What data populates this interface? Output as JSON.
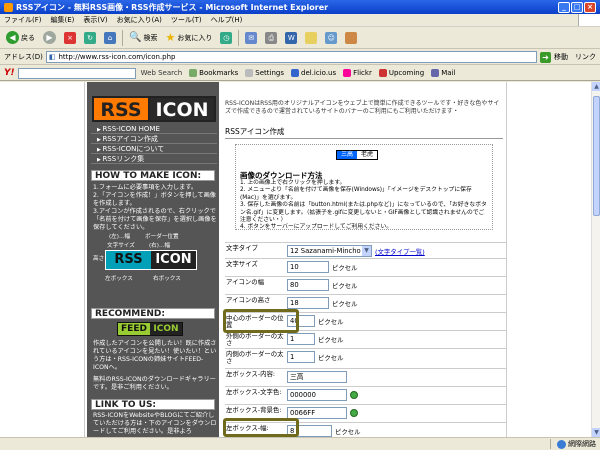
{
  "window": {
    "title": "RSSアイコン - 無料RSS画像・RSS作成サービス - Microsoft Internet Explorer"
  },
  "menubar": [
    "ファイル(F)",
    "編集(E)",
    "表示(V)",
    "お気に入り(A)",
    "ツール(T)",
    "ヘルプ(H)"
  ],
  "toolbar": {
    "back": "戻る",
    "search": "検索",
    "favorites": "お気に入り"
  },
  "address": {
    "label": "アドレス(D)",
    "url": "http://www.rss-icon.com/icon.php",
    "go": "移動",
    "links": "リンク"
  },
  "yahoo_bar": {
    "logo": "Y!",
    "search_btn": "Web Search",
    "bookmarks": "Bookmarks",
    "settings": "Settings",
    "delicious": "del.icio.us",
    "flickr": "Flickr",
    "upcoming": "Upcoming",
    "mail": "Mail"
  },
  "sidebar": {
    "nav": [
      "RSS-ICON HOME",
      "RSSアイコン作成",
      "RSS-ICONについて",
      "RSSリンク集"
    ],
    "logo_rss": "RSS",
    "logo_icon": "ICON",
    "howto_head": "HOW TO MAKE ICON:",
    "howto_text": [
      "1.フォームに必要事項を入力します。",
      "2.「アイコンを作成！」ボタンを押して画像を作成します。",
      "3.アイコンが作成されるので、右クリックで「名前を付けて画像を保存」を選択し画像を保存してください。"
    ],
    "diagram": {
      "box1": "RSS",
      "box2": "ICON",
      "lbl_left_width": "(左)…幅",
      "lbl_border_pos": "ボーダー位置",
      "lbl_right_width": "(右)…幅",
      "lbl_font_size": "文字サイズ",
      "lbl_height": "高さ",
      "lbl_left_box": "左ボックス",
      "lbl_right_box": "右ボックス"
    },
    "recommend_head": "RECOMMEND:",
    "feed1": "FEED",
    "feed2": "ICON",
    "recommend_text": [
      "作成したアイコンを公開したい！既に作成されているアイコンを見たい！使いたい！という方は・RSS-ICONの姉妹サイトFEED-ICONへ。",
      "無料のRSS-ICONのダウンロードギャラリーです。是非ご利用ください。"
    ],
    "linkto_head": "LINK TO US:",
    "linkto_text": [
      "RSS-ICONをWebsiteやBLOGにてご紹介していただける方は・下のアイコンをダウンロードしてご利用ください。是非よろ"
    ]
  },
  "main": {
    "intro": "RSS-ICONはRSS用のオリジナルアイコンをウェブ上で簡単に作成できるツールです・好きな色やサイズで作成できるので運営されているサイトのバナーのご利用にもご利用いただけます・",
    "heading": "RSSアイコン作成",
    "preview_left": "三高",
    "preview_right": "老虎",
    "download_head": "画像のダウンロード方法",
    "download_steps": [
      "1. 上の画像上で右クリックを押します。",
      "2. メニューより「名前を付けて画像を保存(Windows)」「イメージをデスクトップに保存(Mac)」を選びます。",
      "3. 保存した画像の名前は「button.html(または.phpなど)」になっているので、「お好きなボタン名.gif」に変更します。（拡張子を.gifに変更しないと・GIF画像として認識されませんのでご注意ください・）",
      "4. ボタンをサーバーにアップロードしてご利用ください。"
    ],
    "fields": {
      "font_type": {
        "label": "文字タイプ",
        "value": "12 Sazanami-Mincho",
        "link": "(文字タイプ一覧)"
      },
      "font_size": {
        "label": "文字サイズ",
        "value": "10",
        "unit": "ピクセル"
      },
      "icon_width": {
        "label": "アイコンの幅",
        "value": "80",
        "unit": "ピクセル"
      },
      "icon_height": {
        "label": "アイコンの高さ",
        "value": "18",
        "unit": "ピクセル"
      },
      "border_pos": {
        "label": "中心のボーダーの位置",
        "value": "40",
        "unit": "ピクセル"
      },
      "outer_border": {
        "label": "外側のボーダーの太さ",
        "value": "1",
        "unit": "ピクセル"
      },
      "inner_border": {
        "label": "内側のボーダーの太さ",
        "value": "1",
        "unit": "ピクセル"
      },
      "left_text": {
        "label": "左ボックス-内容:",
        "value": "三高"
      },
      "left_color": {
        "label": "左ボックス-文字色:",
        "value": "000000"
      },
      "left_bg": {
        "label": "左ボックス-背景色:",
        "value": "0066FF"
      },
      "left_width": {
        "label": "左ボックス-幅:",
        "value": "8",
        "unit": "ピクセル"
      }
    }
  },
  "status": {
    "left": "",
    "zone": "網際網路"
  }
}
